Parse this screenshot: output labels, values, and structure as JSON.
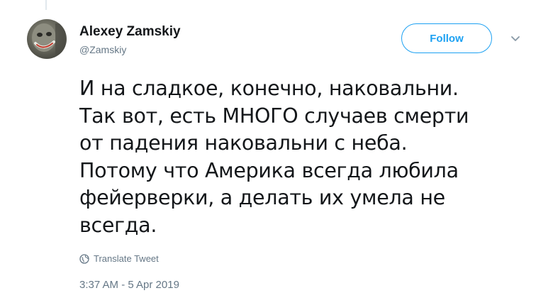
{
  "tweet": {
    "author_name": "Alexey Zamskiy",
    "author_handle": "@Zamskiy",
    "follow_label": "Follow",
    "text": "И на сладкое, конечно, наковальни.\nТак вот, есть МНОГО случаев смерти\nот падения наковальни с неба.\nПотому что Америка всегда любила\nфейерверки, а делать их умела не\nвсегда.",
    "translate_label": "Translate Tweet",
    "timestamp": "3:37 AM - 5 Apr 2019"
  },
  "colors": {
    "accent": "#1da1f2",
    "secondary_text": "#657786",
    "primary_text": "#14171a"
  },
  "icons": {
    "more": "chevron-down-icon",
    "translate": "globe-icon"
  }
}
